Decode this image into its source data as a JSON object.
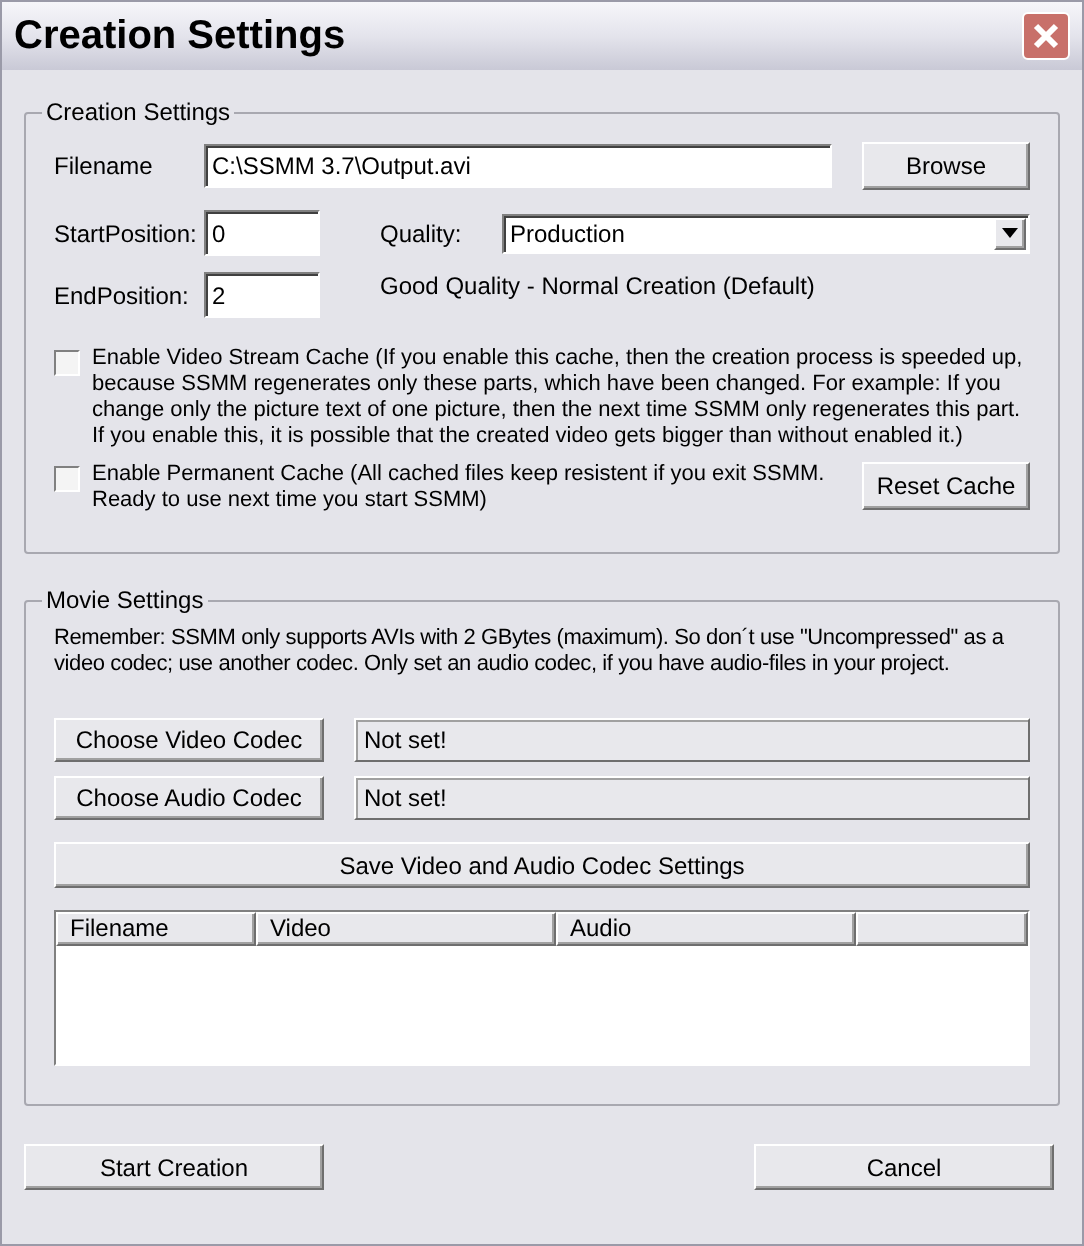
{
  "window": {
    "title": "Creation Settings"
  },
  "creation_settings": {
    "title": "Creation Settings",
    "filename_label": "Filename",
    "filename_value": "C:\\SSMM 3.7\\Output.avi",
    "browse_button": "Browse",
    "start_label": "StartPosition:",
    "start_value": "0",
    "end_label": "EndPosition:",
    "end_value": "2",
    "quality_label": "Quality:",
    "quality_value": "Production",
    "quality_description": "Good Quality - Normal Creation (Default)",
    "options": [
      {
        "label": "Enable Video Stream Cache (If you enable this cache, then the creation process is speeded up, because SSMM regenerates only these parts, which have been changed. For example: If you change only the picture text of one picture, then the next time SSMM only regenerates this part. If you enable this, it is possible that the created video gets bigger than without enabled it.)",
        "checked": false
      },
      {
        "label": "Enable Permanent Cache (All cached files keep resistent if you exit SSMM. Ready to use next time you start SSMM)",
        "checked": false
      }
    ],
    "reset_button": "Reset Cache"
  },
  "movie_settings": {
    "title": "Movie Settings",
    "note": "Remember: SSMM only supports AVIs with 2 GBytes (maximum). So don´t use \"Uncompressed\" as a video codec; use another codec. Only set an audio codec, if you have audio-files in your project.",
    "codecs": [
      {
        "button": "Choose Video Codec",
        "value": "Not set!"
      },
      {
        "button": "Choose Audio Codec",
        "value": "Not set!"
      }
    ],
    "save_button": "Save Video and Audio Codec Settings",
    "table": {
      "columns": [
        "Filename",
        "Video",
        "Audio"
      ]
    }
  },
  "buttons": [
    "Start Creation",
    "Cancel"
  ]
}
